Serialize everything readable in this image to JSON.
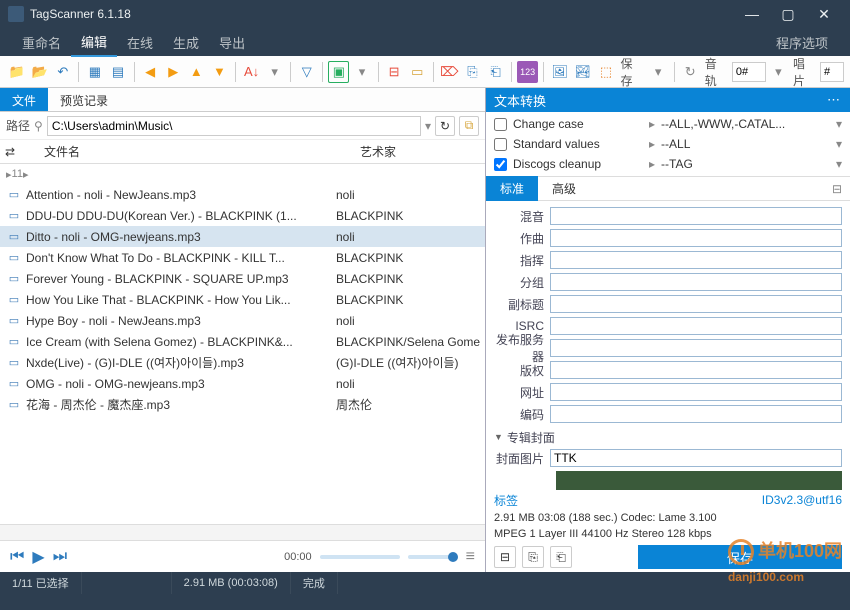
{
  "window": {
    "title": "TagScanner 6.1.18"
  },
  "menu": {
    "items": [
      "重命名",
      "编辑",
      "在线",
      "生成",
      "导出"
    ],
    "active": 1,
    "right": "程序选项"
  },
  "toolbar": {
    "save_label": "保存",
    "track_label": "音轨",
    "track_val": "0#",
    "disc_label": "唱片",
    "disc_val": "#"
  },
  "left": {
    "tabs": [
      "文件",
      "预览记录"
    ],
    "active": 0,
    "path_label": "路径",
    "path": "C:\\Users\\admin\\Music\\",
    "cols": [
      "文件名",
      "艺术家"
    ],
    "group": "11",
    "rows": [
      {
        "name": "Attention - noli - NewJeans.mp3",
        "artist": "noli"
      },
      {
        "name": "DDU-DU DDU-DU(Korean Ver.) - BLACKPINK (1...",
        "artist": "BLACKPINK"
      },
      {
        "name": "Ditto - noli - OMG-newjeans.mp3",
        "artist": "noli",
        "selected": true
      },
      {
        "name": "Don't Know What To Do - BLACKPINK - KILL T...",
        "artist": "BLACKPINK"
      },
      {
        "name": "Forever Young - BLACKPINK - SQUARE UP.mp3",
        "artist": "BLACKPINK"
      },
      {
        "name": "How You Like That - BLACKPINK - How You Lik...",
        "artist": "BLACKPINK"
      },
      {
        "name": "Hype Boy - noli - NewJeans.mp3",
        "artist": "noli"
      },
      {
        "name": "Ice Cream (with Selena Gomez) - BLACKPINK&...",
        "artist": "BLACKPINK/Selena Gome"
      },
      {
        "name": "Nxde(Live) - (G)I-DLE ((여자)아이들).mp3",
        "artist": "(G)I-DLE ((여자)아이들)"
      },
      {
        "name": "OMG - noli - OMG-newjeans.mp3",
        "artist": "noli"
      },
      {
        "name": "花海 - 周杰伦 - 魔杰座.mp3",
        "artist": "周杰伦"
      }
    ],
    "time": "00:00"
  },
  "right": {
    "panel_title": "文本转换",
    "checks": [
      {
        "label": "Change case",
        "value": "--ALL,-WWW,-CATAL...",
        "checked": false
      },
      {
        "label": "Standard values",
        "value": "--ALL",
        "checked": false
      },
      {
        "label": "Discogs cleanup",
        "value": "--TAG",
        "checked": true
      }
    ],
    "subtabs": [
      "标准",
      "高级"
    ],
    "subactive": 0,
    "fields": [
      {
        "label": "混音",
        "value": ""
      },
      {
        "label": "作曲",
        "value": ""
      },
      {
        "label": "指挥",
        "value": ""
      },
      {
        "label": "分组",
        "value": ""
      },
      {
        "label": "副标题",
        "value": ""
      },
      {
        "label": "ISRC",
        "value": ""
      },
      {
        "label": "发布服务器",
        "value": ""
      },
      {
        "label": "版权",
        "value": ""
      },
      {
        "label": "网址",
        "value": ""
      },
      {
        "label": "编码",
        "value": ""
      }
    ],
    "album_section": "专辑封面",
    "cover_label": "封面图片",
    "cover_value": "TTK",
    "tag_label": "标签",
    "tag_info": "ID3v2.3@utf16",
    "info1": "2.91 MB  03:08 (188 sec.)  Codec: Lame 3.100",
    "info2": "MPEG 1 Layer III   44100 Hz  Stereo  128 kbps",
    "save_btn": "保存"
  },
  "status": {
    "sel": "1/11 已选择",
    "size": "2.91 MB (00:03:08)",
    "done": "完成"
  },
  "watermark": "单机100网\ndanji100.com"
}
